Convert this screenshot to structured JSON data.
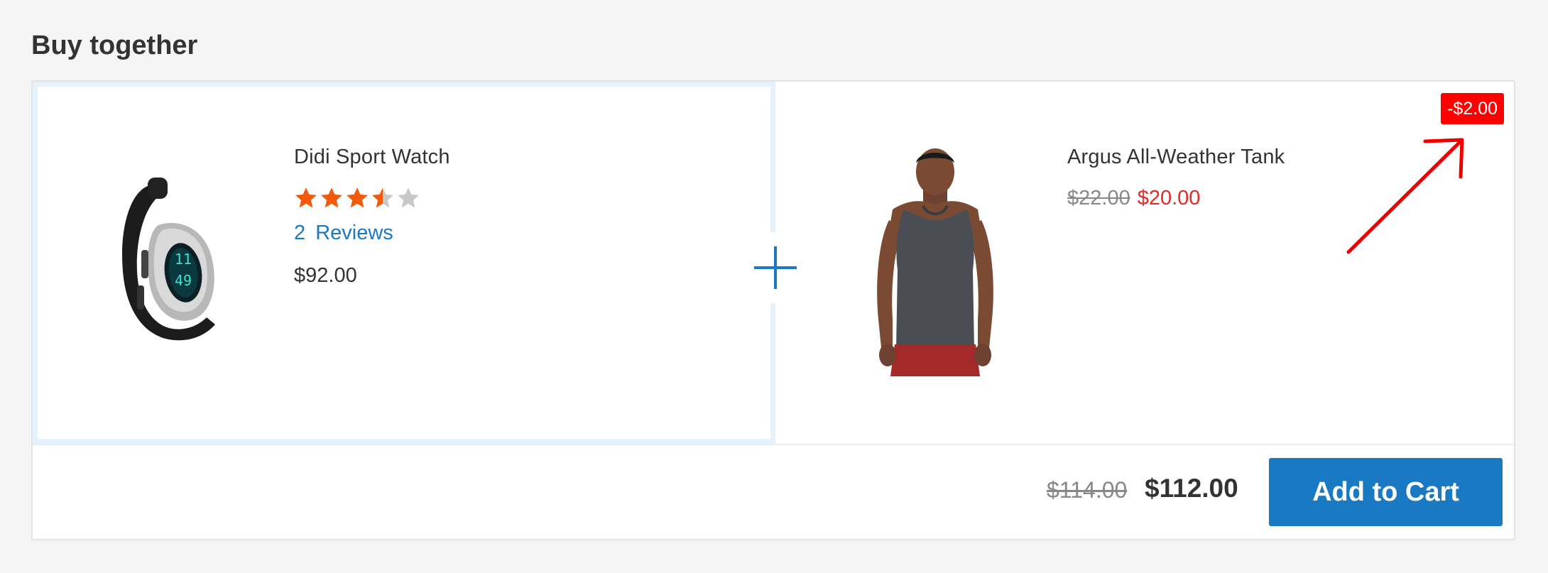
{
  "section": {
    "title": "Buy together"
  },
  "products": [
    {
      "name": "Didi Sport Watch",
      "rating": {
        "value": 3.5,
        "max": 5
      },
      "reviews_count": "2",
      "reviews_label": "Reviews",
      "price": "$92.00",
      "image_icon": "sport-watch"
    },
    {
      "name": "Argus All-Weather Tank",
      "old_price": "$22.00",
      "special_price": "$20.00",
      "discount_badge": "-$2.00",
      "image_icon": "man-in-tank-top"
    }
  ],
  "footer": {
    "old_total": "$114.00",
    "final_total": "$112.00",
    "add_to_cart_label": "Add to Cart"
  },
  "colors": {
    "accent_blue": "#1979c3",
    "star_filled": "#f15a0d",
    "star_empty": "#c8c8c8",
    "sale_red": "#e02b27",
    "badge_red": "#ff0000"
  }
}
